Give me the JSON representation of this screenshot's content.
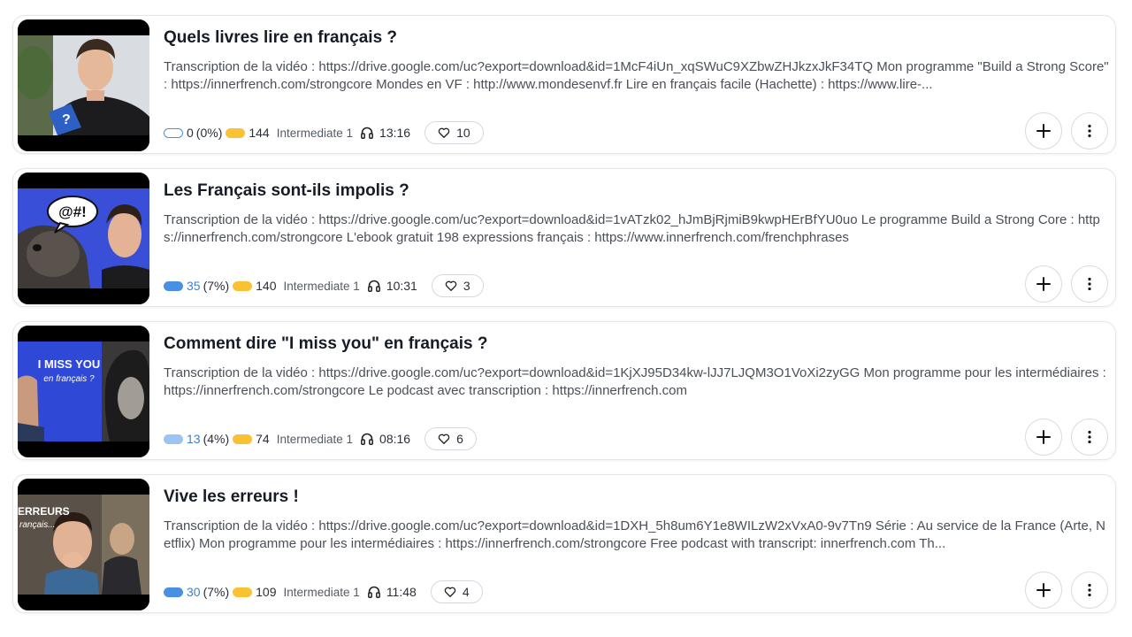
{
  "lessons": [
    {
      "title": "Quels livres lire en français ?",
      "description": "Transcription de la vidéo : https://drive.google.com/uc?export=download&id=1McF4iUn_xqSWuC9XZbwZHJkzxJkF34TQ Mon programme \"Build a Strong Score\" : https://innerfrench.com/strongcore Mondes en VF : http://www.mondesenvf.fr Lire en français facile (Hachette) : https://www.lire-...",
      "known_count": "0",
      "known_pct": "(0%)",
      "known_level": 0,
      "lingq_count": "144",
      "level": "Intermediate 1",
      "duration": "13:16",
      "likes": "10"
    },
    {
      "title": "Les Français sont-ils impolis ?",
      "description": "Transcription de la vidéo : https://drive.google.com/uc?export=download&id=1vATzk02_hJmBjRjmiB9kwpHErBfYU0uo Le programme Build a Strong Core : https://innerfrench.com/strongcore L'ebook gratuit 198 expressions français : https://www.innerfrench.com/frenchphrases",
      "known_count": "35",
      "known_pct": "(7%)",
      "known_level": 2,
      "lingq_count": "140",
      "level": "Intermediate 1",
      "duration": "10:31",
      "likes": "3"
    },
    {
      "title": "Comment dire \"I miss you\" en français ?",
      "description": "Transcription de la vidéo : https://drive.google.com/uc?export=download&id=1KjXJ95D34kw-lJJ7LJQM3O1VoXi2zyGG Mon programme pour les intermédiaires : https://innerfrench.com/strongcore Le podcast avec transcription : https://innerfrench.com",
      "known_count": "13",
      "known_pct": "(4%)",
      "known_level": 1,
      "lingq_count": "74",
      "level": "Intermediate 1",
      "duration": "08:16",
      "likes": "6"
    },
    {
      "title": "Vive les erreurs !",
      "description": "Transcription de la vidéo : https://drive.google.com/uc?export=download&id=1DXH_5h8um6Y1e8WILzW2xVxA0-9v7Tn9 Série : Au service de la France (Arte, Netflix) Mon programme pour les intermédiaires : https://innerfrench.com/strongcore Free podcast with transcript: innerfrench.com Th...",
      "known_count": "30",
      "known_pct": "(7%)",
      "known_level": 2,
      "lingq_count": "109",
      "level": "Intermediate 1",
      "duration": "11:48",
      "likes": "4"
    }
  ],
  "thumbnails": {
    "t2_bubble": "@#!",
    "t3_line1": "I MISS YOU",
    "t3_line2": "en français ?",
    "t4_line1": "ERREURS",
    "t4_line2": "rançais..."
  },
  "icons": {
    "add": "plus-icon",
    "more": "more-vertical-icon",
    "listen": "headphones-icon",
    "like": "heart-icon",
    "known": "known-words-pill",
    "lingq": "lingq-pill"
  },
  "colors": {
    "known_blue": "#4a90e2",
    "known_light": "#9cc4f2",
    "lingq_yellow": "#f8c234",
    "title": "#161b26"
  }
}
